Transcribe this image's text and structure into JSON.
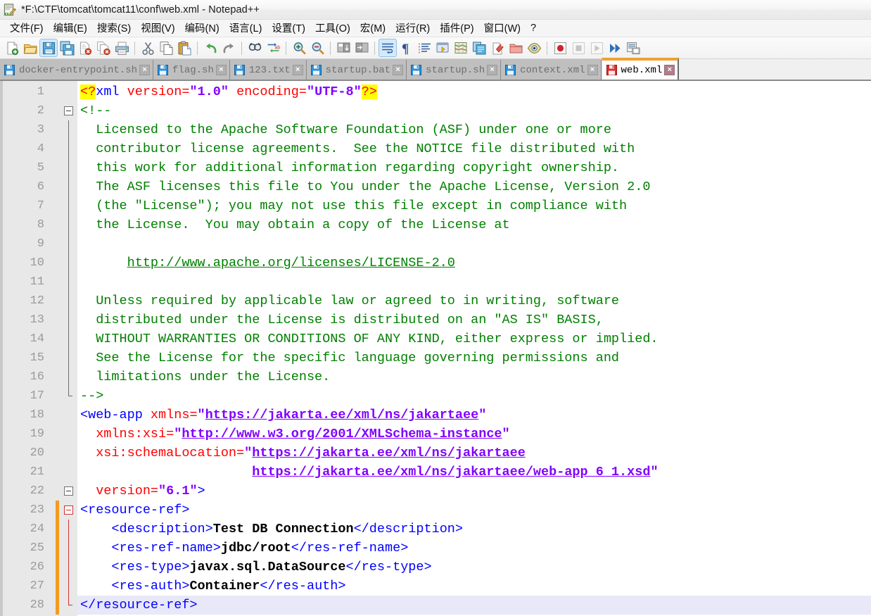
{
  "window": {
    "title": "*F:\\CTF\\tomcat\\tomcat11\\conf\\web.xml - Notepad++",
    "app_icon": "notepad-plus-plus-icon",
    "modified_marker": "*"
  },
  "menubar": {
    "items": [
      {
        "label": "文件(F)",
        "name": "menu-file"
      },
      {
        "label": "编辑(E)",
        "name": "menu-edit"
      },
      {
        "label": "搜索(S)",
        "name": "menu-search"
      },
      {
        "label": "视图(V)",
        "name": "menu-view"
      },
      {
        "label": "编码(N)",
        "name": "menu-encoding"
      },
      {
        "label": "语言(L)",
        "name": "menu-language"
      },
      {
        "label": "设置(T)",
        "name": "menu-settings"
      },
      {
        "label": "工具(O)",
        "name": "menu-tools"
      },
      {
        "label": "宏(M)",
        "name": "menu-macro"
      },
      {
        "label": "运行(R)",
        "name": "menu-run"
      },
      {
        "label": "插件(P)",
        "name": "menu-plugins"
      },
      {
        "label": "窗口(W)",
        "name": "menu-window"
      },
      {
        "label": "?",
        "name": "menu-help"
      }
    ]
  },
  "toolbar": {
    "buttons": [
      {
        "icon": "new-file-icon",
        "tooltip": "新建"
      },
      {
        "icon": "open-file-icon",
        "tooltip": "打开"
      },
      {
        "icon": "save-icon",
        "tooltip": "保存",
        "state": "active"
      },
      {
        "icon": "save-all-icon",
        "tooltip": "保存全部"
      },
      {
        "icon": "close-file-icon",
        "tooltip": "关闭"
      },
      {
        "icon": "close-all-icon",
        "tooltip": "关闭全部"
      },
      {
        "icon": "print-icon",
        "tooltip": "打印"
      },
      {
        "icon": "cut-icon",
        "tooltip": "剪切"
      },
      {
        "icon": "copy-icon",
        "tooltip": "复制"
      },
      {
        "icon": "paste-icon",
        "tooltip": "粘贴"
      },
      {
        "icon": "undo-icon",
        "tooltip": "撤销"
      },
      {
        "icon": "redo-icon",
        "tooltip": "重做"
      },
      {
        "icon": "find-icon",
        "tooltip": "查找"
      },
      {
        "icon": "replace-icon",
        "tooltip": "替换"
      },
      {
        "icon": "zoom-in-icon",
        "tooltip": "放大"
      },
      {
        "icon": "zoom-out-icon",
        "tooltip": "缩小"
      },
      {
        "icon": "sync-vertical-scroll-icon",
        "tooltip": "同步垂直滚动"
      },
      {
        "icon": "sync-horizontal-scroll-icon",
        "tooltip": "同步水平滚动"
      },
      {
        "icon": "word-wrap-icon",
        "tooltip": "自动换行",
        "state": "active"
      },
      {
        "icon": "show-all-characters-icon",
        "tooltip": "显示所有字符"
      },
      {
        "icon": "indent-guide-icon",
        "tooltip": "显示缩进参考线"
      },
      {
        "icon": "user-defined-language-icon",
        "tooltip": "用户自定义语言"
      },
      {
        "icon": "document-map-icon",
        "tooltip": "文档映射"
      },
      {
        "icon": "function-list-icon",
        "tooltip": "函数列表"
      },
      {
        "icon": "document-switcher-icon",
        "tooltip": "文档列表"
      },
      {
        "icon": "folder-as-workspace-icon",
        "tooltip": "文件夹作为工作区"
      },
      {
        "icon": "monitoring-icon",
        "tooltip": "监视"
      },
      {
        "icon": "record-macro-icon",
        "tooltip": "开始录制宏"
      },
      {
        "icon": "stop-macro-icon",
        "tooltip": "停止录制宏",
        "state": "disabled"
      },
      {
        "icon": "play-macro-icon",
        "tooltip": "播放宏",
        "state": "disabled"
      },
      {
        "icon": "run-macro-multiple-icon",
        "tooltip": "多次运行宏"
      },
      {
        "icon": "save-macro-icon",
        "tooltip": "保存当前宏"
      }
    ]
  },
  "tabs": {
    "items": [
      {
        "label": "docker-entrypoint.sh",
        "active": false,
        "saved": true,
        "icon": "floppy-save-icon",
        "close": "×"
      },
      {
        "label": "flag.sh",
        "active": false,
        "saved": true,
        "icon": "floppy-save-icon",
        "close": "×"
      },
      {
        "label": "123.txt",
        "active": false,
        "saved": true,
        "icon": "floppy-save-icon",
        "close": "×"
      },
      {
        "label": "startup.bat",
        "active": false,
        "saved": true,
        "icon": "floppy-save-icon",
        "close": "×"
      },
      {
        "label": "startup.sh",
        "active": false,
        "saved": true,
        "icon": "floppy-save-icon",
        "close": "×"
      },
      {
        "label": "context.xml",
        "active": false,
        "saved": true,
        "icon": "floppy-save-icon",
        "close": "×"
      },
      {
        "label": "web.xml",
        "active": true,
        "saved": false,
        "icon": "floppy-unsaved-icon",
        "close": "×"
      }
    ],
    "active_index": 6
  },
  "editor": {
    "language": "XML",
    "current_line": 28,
    "first_visible_line": 1,
    "last_visible_line": 28,
    "colors": {
      "tag": "#0000ff",
      "attribute": "#ff0000",
      "attribute_value": "#8000ff",
      "comment": "#008000",
      "text_content": "#000000",
      "match_highlight": "#ffff00",
      "current_line_background": "#e8e8f8",
      "margin_background": "#e8e8e8",
      "line_number": "#9a9a9a",
      "change_marker": "#f59a21",
      "fold_active": "#d03030"
    },
    "line_numbers": [
      1,
      2,
      3,
      4,
      5,
      6,
      7,
      8,
      9,
      10,
      11,
      12,
      13,
      14,
      15,
      16,
      17,
      18,
      19,
      20,
      21,
      22,
      23,
      24,
      25,
      26,
      27,
      28
    ],
    "modified_lines": [
      23,
      24,
      25,
      26,
      27,
      28
    ],
    "lines": [
      {
        "n": 1,
        "text": "<?xml version=\"1.0\" encoding=\"UTF-8\"?>"
      },
      {
        "n": 2,
        "text": "<!--"
      },
      {
        "n": 3,
        "text": "  Licensed to the Apache Software Foundation (ASF) under one or more"
      },
      {
        "n": 4,
        "text": "  contributor license agreements.  See the NOTICE file distributed with"
      },
      {
        "n": 5,
        "text": "  this work for additional information regarding copyright ownership."
      },
      {
        "n": 6,
        "text": "  The ASF licenses this file to You under the Apache License, Version 2.0"
      },
      {
        "n": 7,
        "text": "  (the \"License\"); you may not use this file except in compliance with"
      },
      {
        "n": 8,
        "text": "  the License.  You may obtain a copy of the License at"
      },
      {
        "n": 9,
        "text": ""
      },
      {
        "n": 10,
        "text": "      http://www.apache.org/licenses/LICENSE-2.0"
      },
      {
        "n": 11,
        "text": ""
      },
      {
        "n": 12,
        "text": "  Unless required by applicable law or agreed to in writing, software"
      },
      {
        "n": 13,
        "text": "  distributed under the License is distributed on an \"AS IS\" BASIS,"
      },
      {
        "n": 14,
        "text": "  WITHOUT WARRANTIES OR CONDITIONS OF ANY KIND, either express or implied."
      },
      {
        "n": 15,
        "text": "  See the License for the specific language governing permissions and"
      },
      {
        "n": 16,
        "text": "  limitations under the License."
      },
      {
        "n": 17,
        "text": "-->"
      },
      {
        "n": 18,
        "text": "<web-app xmlns=\"https://jakarta.ee/xml/ns/jakartaee\""
      },
      {
        "n": 19,
        "text": "  xmlns:xsi=\"http://www.w3.org/2001/XMLSchema-instance\""
      },
      {
        "n": 20,
        "text": "  xsi:schemaLocation=\"https://jakarta.ee/xml/ns/jakartaee"
      },
      {
        "n": 21,
        "text": "                      https://jakarta.ee/xml/ns/jakartaee/web-app_6_1.xsd\""
      },
      {
        "n": 22,
        "text": "  version=\"6.1\">"
      },
      {
        "n": 23,
        "text": "<resource-ref>"
      },
      {
        "n": 24,
        "text": "    <description>Test DB Connection</description>"
      },
      {
        "n": 25,
        "text": "    <res-ref-name>jdbc/root</res-ref-name>"
      },
      {
        "n": 26,
        "text": "    <res-type>javax.sql.DataSource</res-type>"
      },
      {
        "n": 27,
        "text": "    <res-auth>Container</res-auth>"
      },
      {
        "n": 28,
        "text": "</resource-ref>"
      }
    ],
    "tokens": {
      "l1": {
        "open": "<?",
        "name": "xml",
        "a1": " version=",
        "v1": "\"1.0\"",
        "a2": " encoding=",
        "v2": "\"UTF-8\"",
        "close": "?>"
      },
      "l2": "<!--",
      "l3": "  Licensed to the Apache Software Foundation (ASF) under one or more",
      "l4": "  contributor license agreements.  See the NOTICE file distributed with",
      "l5": "  this work for additional information regarding copyright ownership.",
      "l6": "  The ASF licenses this file to You under the Apache License, Version 2.0",
      "l7": "  (the \"License\"); you may not use this file except in compliance with",
      "l8": "  the License.  You may obtain a copy of the License at",
      "l10_indent": "      ",
      "l10_url": "http://www.apache.org/licenses/LICENSE-2.0",
      "l12": "  Unless required by applicable law or agreed to in writing, software",
      "l13": "  distributed under the License is distributed on an \"AS IS\" BASIS,",
      "l14": "  WITHOUT WARRANTIES OR CONDITIONS OF ANY KIND, either express or implied.",
      "l15": "  See the License for the specific language governing permissions and",
      "l16": "  limitations under the License.",
      "l17": "-->",
      "l18": {
        "tag": "<web-app",
        "attr": " xmlns=",
        "q1": "\"",
        "url": "https://jakarta.ee/xml/ns/jakartaee",
        "q2": "\""
      },
      "l19": {
        "attr": "  xmlns:xsi=",
        "q1": "\"",
        "url": "http://www.w3.org/2001/XMLSchema-instance",
        "q2": "\""
      },
      "l20": {
        "attr": "  xsi:schemaLocation=",
        "q1": "\"",
        "url": "https://jakarta.ee/xml/ns/jakartaee"
      },
      "l21": {
        "indent": "                      ",
        "url": "https://jakarta.ee/xml/ns/jakartaee/web-app_6_1.xsd",
        "q2": "\""
      },
      "l22": {
        "attr": "  version=",
        "val": "\"6.1\"",
        "close": ">"
      },
      "l23": "<resource-ref>",
      "l24": {
        "open": "    <description>",
        "text": "Test DB Connection",
        "close": "</description>"
      },
      "l25": {
        "open": "    <res-ref-name>",
        "text": "jdbc/root",
        "close": "</res-ref-name>"
      },
      "l26": {
        "open": "    <res-type>",
        "text": "javax.sql.DataSource",
        "close": "</res-type>"
      },
      "l27": {
        "open": "    <res-auth>",
        "text": "Container",
        "close": "</res-auth>"
      },
      "l28": "</resource-ref>"
    }
  }
}
